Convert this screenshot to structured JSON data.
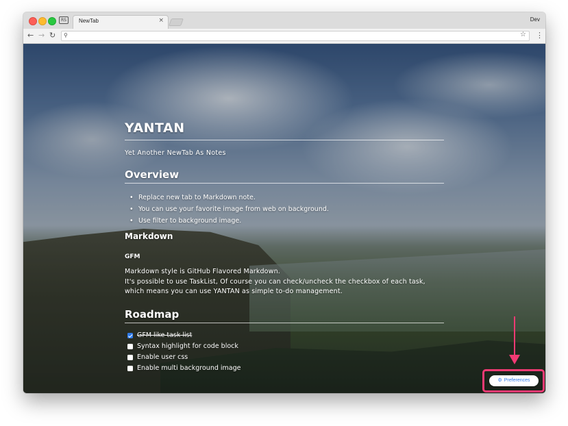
{
  "browser": {
    "tab_title": "NewTab",
    "tab_close": "×",
    "profile_name": "Dev",
    "tab_icon_label": "RS",
    "address_value": ""
  },
  "note": {
    "title": "YANTAN",
    "subtitle": "Yet Another NewTab As Notes",
    "overview_heading": "Overview",
    "overview_items": [
      "Replace new tab to Markdown note.",
      "You can use your favorite image from web on background.",
      "Use filter to background image."
    ],
    "markdown_heading": "Markdown",
    "gfm_heading": "GFM",
    "gfm_paragraph": [
      "Markdown style is GitHub Flavored Markdown.",
      "It's possible to use TaskList, Of course you can check/uncheck the checkbox of each task,",
      "which means you can use YANTAN as simple to-do management."
    ],
    "roadmap_heading": "Roadmap",
    "tasks": [
      {
        "label": "GFM like task list",
        "checked": true
      },
      {
        "label": "Syntax highlight for code block",
        "checked": false
      },
      {
        "label": "Enable user css",
        "checked": false
      },
      {
        "label": "Enable multi background image",
        "checked": false
      }
    ]
  },
  "preferences": {
    "label": "Preferences",
    "icon": "gear-icon"
  },
  "colors": {
    "highlight": "#f23a74",
    "accent": "#2f7bea"
  }
}
